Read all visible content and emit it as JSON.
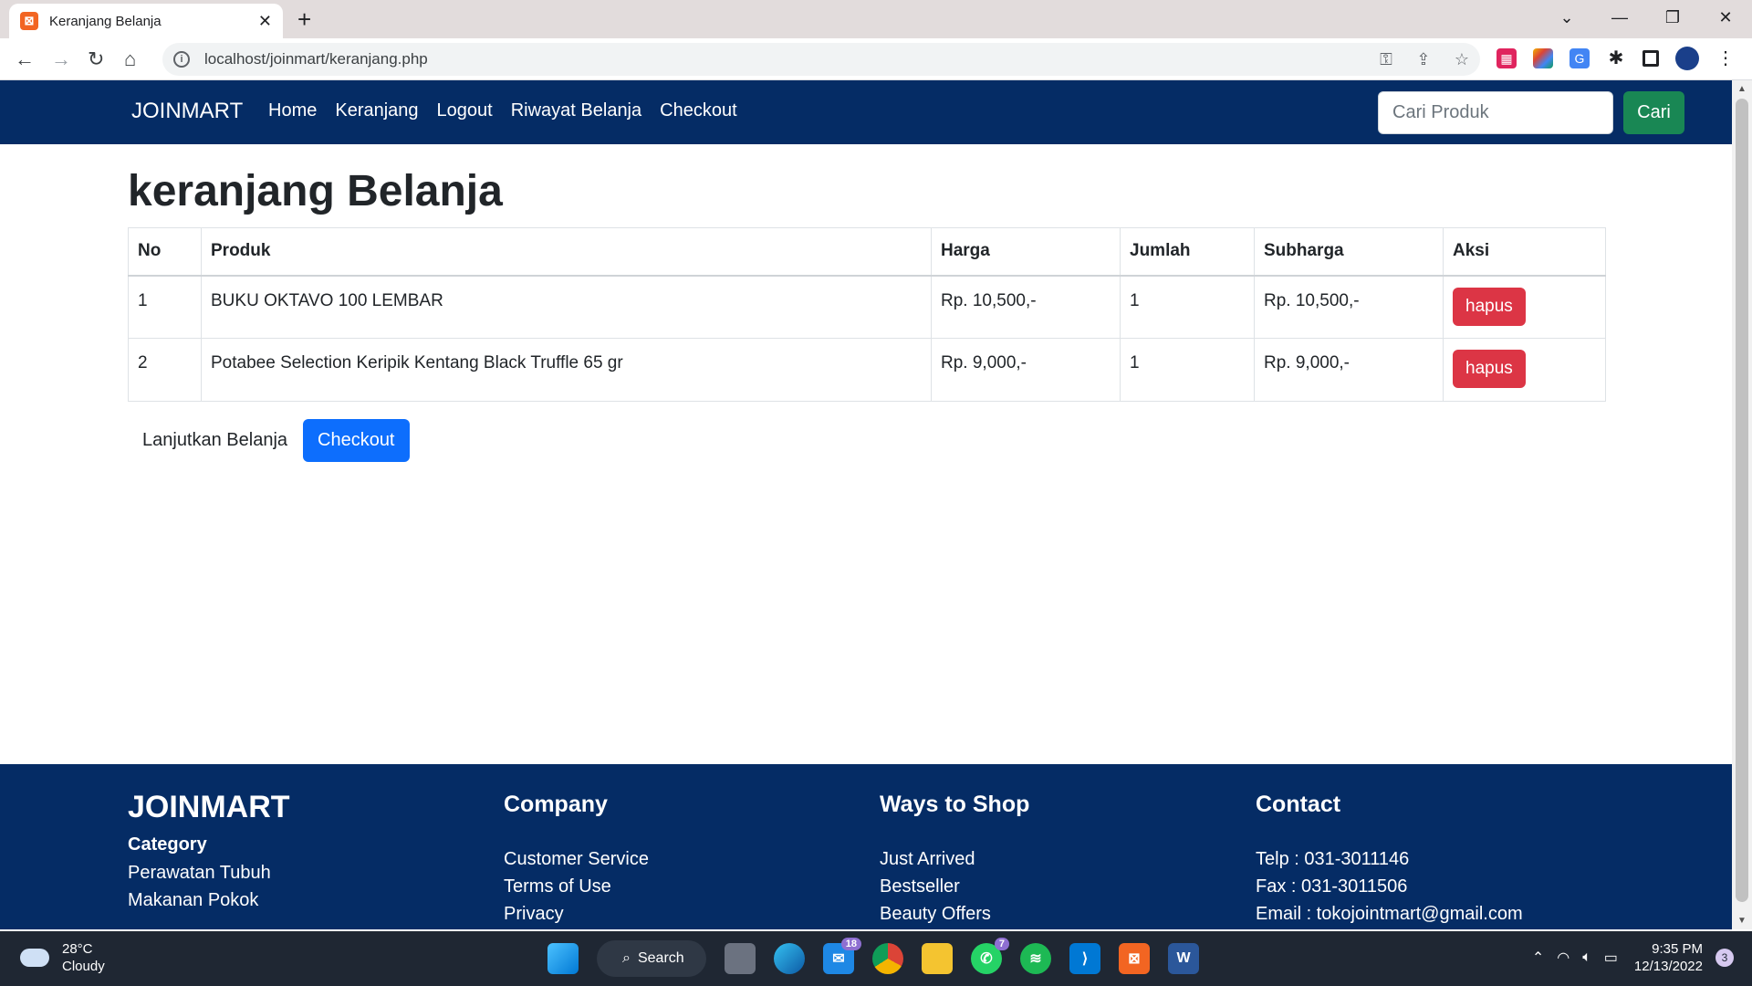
{
  "browser": {
    "tab_title": "Keranjang Belanja",
    "tab_favicon": "⊠",
    "tab_close": "✕",
    "new_tab": "+",
    "url": "localhost/joinmart/keranjang.php",
    "win_controls": [
      "⌄",
      "—",
      "❐",
      "✕"
    ]
  },
  "navbar": {
    "brand": "JOINMART",
    "links": [
      "Home",
      "Keranjang",
      "Logout",
      "Riwayat Belanja",
      "Checkout"
    ],
    "search_placeholder": "Cari Produk",
    "search_button": "Cari"
  },
  "page": {
    "title": "keranjang Belanja"
  },
  "cart": {
    "headers": [
      "No",
      "Produk",
      "Harga",
      "Jumlah",
      "Subharga",
      "Aksi"
    ],
    "rows": [
      {
        "no": "1",
        "produk": "BUKU OKTAVO 100 LEMBAR",
        "harga": "Rp. 10,500,-",
        "jumlah": "1",
        "subharga": "Rp. 10,500,-",
        "aksi": "hapus"
      },
      {
        "no": "2",
        "produk": "Potabee Selection Keripik Kentang Black Truffle 65 gr",
        "harga": "Rp. 9,000,-",
        "jumlah": "1",
        "subharga": "Rp. 9,000,-",
        "aksi": "hapus"
      }
    ],
    "continue_label": "Lanjutkan Belanja",
    "checkout_label": "Checkout"
  },
  "footer": {
    "brand": "JOINMART",
    "category_title": "Category",
    "categories": [
      "Perawatan Tubuh",
      "Makanan Pokok"
    ],
    "company_title": "Company",
    "company_items": [
      "Customer Service",
      "Terms of Use",
      "Privacy"
    ],
    "shop_title": "Ways to Shop",
    "shop_items": [
      "Just Arrived",
      "Bestseller",
      "Beauty Offers"
    ],
    "contact_title": "Contact",
    "contact_items": [
      "Telp : 031-3011146",
      "Fax : 031-3011506",
      "Email : tokojointmart@gmail.com"
    ]
  },
  "taskbar": {
    "temp": "28°C",
    "weather": "Cloudy",
    "search_label": "Search",
    "mail_badge": "18",
    "whatsapp_badge": "7",
    "time": "9:35 PM",
    "date": "12/13/2022",
    "notifications": "3"
  },
  "colors": {
    "navbar": "#052c65",
    "search_button": "#198754",
    "checkout_button": "#0d6efd",
    "hapus_button": "#dc3545"
  }
}
